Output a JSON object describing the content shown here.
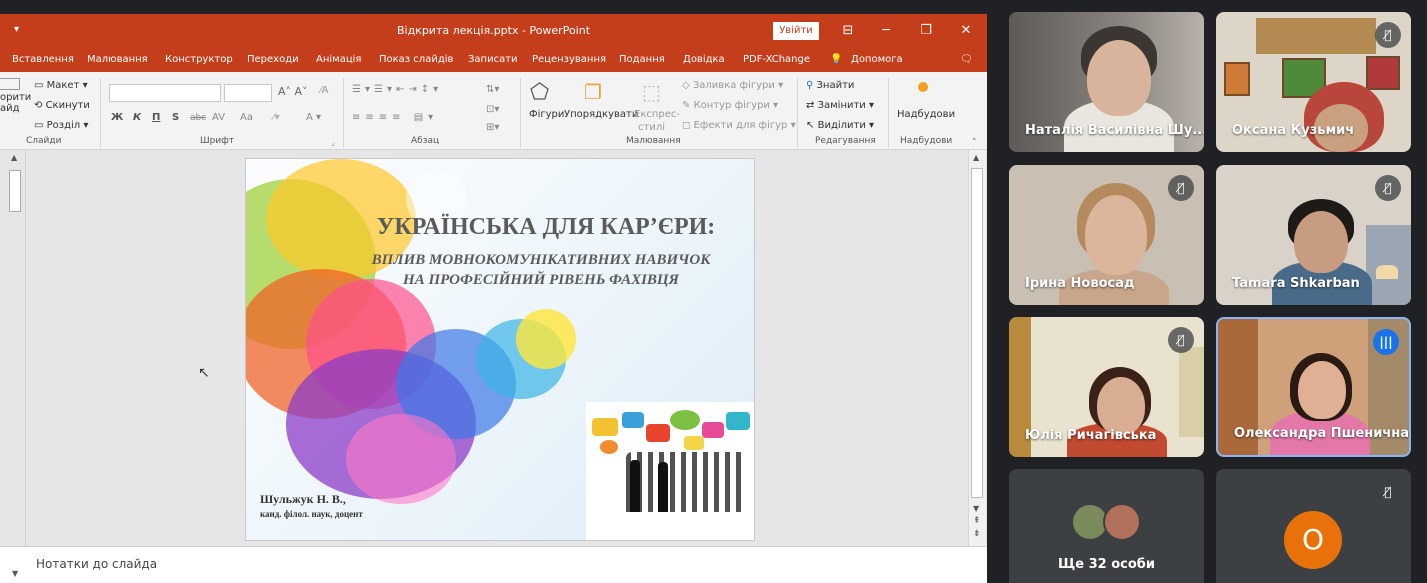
{
  "ppt": {
    "qat_icon": "save-icon",
    "title": "Відкрита лекція.pptx  -  PowerPoint",
    "signin": "Увійти",
    "tabs": [
      "Вставлення",
      "Малювання",
      "Конструктор",
      "Переходи",
      "Анімація",
      "Показ слайдів",
      "Записати",
      "Рецензування",
      "Подання",
      "Довідка",
      "PDF-XChange"
    ],
    "help_search": "Допомога",
    "ribbon": {
      "slides": {
        "new_slide_a": "орити",
        "new_slide_b": "айд",
        "layout": "Макет",
        "reset": "Скинути",
        "section": "Розділ",
        "group": "Слайди"
      },
      "font": {
        "bold": "Ж",
        "italic": "К",
        "underline": "П",
        "strike": "S",
        "abc": "abc",
        "av": "AV",
        "aa": "Aa",
        "group": "Шрифт"
      },
      "paragraph": {
        "group": "Абзац"
      },
      "drawing": {
        "shapes": "Фігури",
        "arrange": "Упорядкувати",
        "express_a": "Експрес-",
        "express_b": "стилі",
        "fill": "Заливка фігури",
        "outline": "Контур фігури",
        "effects": "Ефекти для фігур",
        "group": "Малювання"
      },
      "editing": {
        "find": "Знайти",
        "replace": "Замінити",
        "select": "Виділити",
        "group": "Редагування"
      },
      "addins": {
        "label": "Надбудови",
        "group": "Надбудови"
      }
    },
    "slide": {
      "title": "УКРАЇНСЬКА ДЛЯ КАР’ЄРИ:",
      "subtitle_1": "ВПЛИВ МОВНОКОМУНІКАТИВНИХ НАВИЧОК",
      "subtitle_2": "НА ПРОФЕСІЙНИЙ РІВЕНЬ ФАХІВЦЯ",
      "author": "Шульжук Н. В.,",
      "degree": "канд. філол. наук, доцент"
    },
    "notes": "Нотатки до слайда"
  },
  "meet": {
    "tiles": [
      {
        "name": "Наталія Василівна Шу...",
        "muted": false
      },
      {
        "name": "Оксана Кузьмич",
        "muted": true
      },
      {
        "name": "Ірина Новосад",
        "muted": true
      },
      {
        "name": "Tamara Shkarban",
        "muted": true
      },
      {
        "name": "Юлія Ричагівська",
        "muted": true
      },
      {
        "name": "Олександра Пшенична",
        "speaking": true
      }
    ],
    "others": "Ще 32 особи",
    "avatar_letter": "О",
    "colors": {
      "speaking_border": "#8ab4f8",
      "avatar": "#e8710a",
      "ppt_brand": "#c43e1c"
    }
  }
}
